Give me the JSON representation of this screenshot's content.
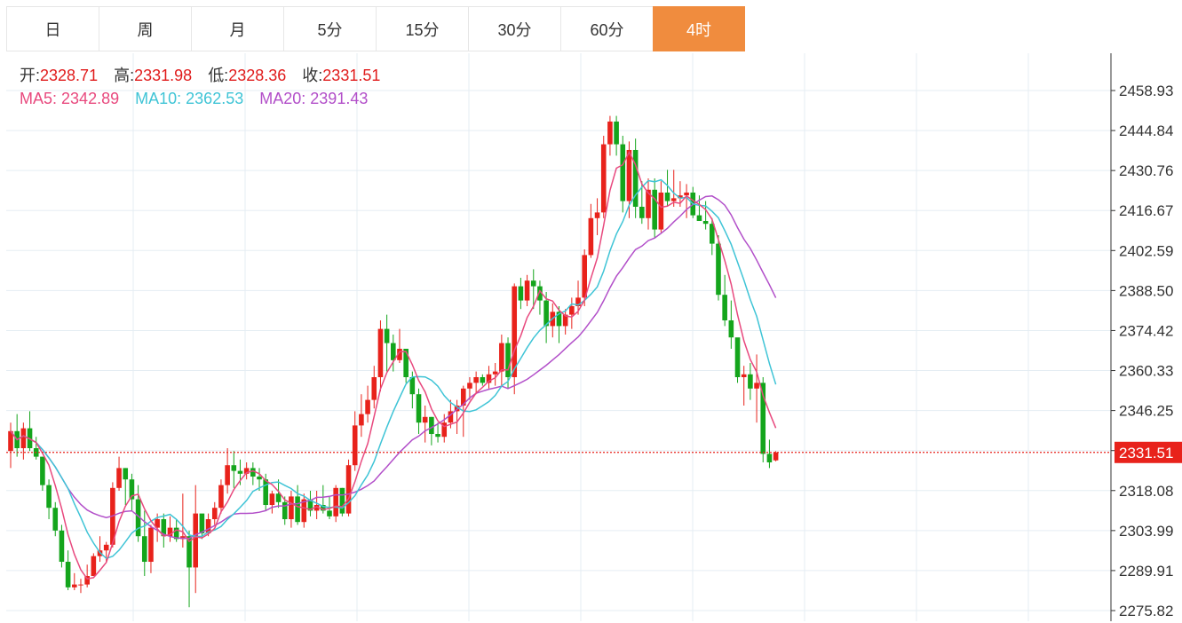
{
  "tabs": [
    {
      "label": "日",
      "active": false
    },
    {
      "label": "周",
      "active": false
    },
    {
      "label": "月",
      "active": false
    },
    {
      "label": "5分",
      "active": false
    },
    {
      "label": "15分",
      "active": false
    },
    {
      "label": "30分",
      "active": false
    },
    {
      "label": "60分",
      "active": false
    },
    {
      "label": "4时",
      "active": true
    }
  ],
  "ohlc_info": {
    "open_label": "开:",
    "open": "2328.71",
    "high_label": "高:",
    "high": "2331.98",
    "low_label": "低:",
    "low": "2328.36",
    "close_label": "收:",
    "close": "2331.51"
  },
  "ma_info": {
    "ma5_label": "MA5:",
    "ma5": "2342.89",
    "ma10_label": "MA10:",
    "ma10": "2362.53",
    "ma20_label": "MA20:",
    "ma20": "2391.43"
  },
  "colors": {
    "up": "#e8221b",
    "down": "#14a51c",
    "ma5": "#e8497e",
    "ma10": "#3fc4d6",
    "ma20": "#b24fc9",
    "price_line": "#e8221b",
    "accent_tab": "#f08c3e",
    "grid": "#e5edf3"
  },
  "chart_data": {
    "type": "candlestick",
    "y_ticks": [
      "2458.93",
      "2444.84",
      "2430.76",
      "2416.67",
      "2402.59",
      "2388.50",
      "2374.42",
      "2360.33",
      "2346.25",
      "2332.16",
      "2318.08",
      "2303.99",
      "2289.91",
      "2275.82"
    ],
    "ylim": [
      2275.82,
      2458.93
    ],
    "last_price_label": "2331.51",
    "last_price": 2331.51,
    "candles": [
      [
        2332,
        2342,
        2326,
        2339
      ],
      [
        2339,
        2345,
        2330,
        2333
      ],
      [
        2333,
        2342,
        2329,
        2340
      ],
      [
        2340,
        2346,
        2332,
        2333
      ],
      [
        2333,
        2337,
        2329,
        2330
      ],
      [
        2330,
        2330,
        2318,
        2320
      ],
      [
        2320,
        2322,
        2308,
        2312
      ],
      [
        2312,
        2314,
        2302,
        2304
      ],
      [
        2304,
        2306,
        2291,
        2293
      ],
      [
        2293,
        2297,
        2283,
        2284
      ],
      [
        2284,
        2289,
        2283,
        2285
      ],
      [
        2285,
        2287,
        2282,
        2285
      ],
      [
        2285,
        2292,
        2284,
        2288
      ],
      [
        2288,
        2296,
        2289,
        2295
      ],
      [
        2295,
        2302,
        2293,
        2297
      ],
      [
        2297,
        2300,
        2293,
        2299
      ],
      [
        2299,
        2321,
        2298,
        2319
      ],
      [
        2319,
        2330,
        2318,
        2326
      ],
      [
        2326,
        2326,
        2313,
        2322
      ],
      [
        2322,
        2324,
        2311,
        2315
      ],
      [
        2315,
        2320,
        2300,
        2302
      ],
      [
        2302,
        2311,
        2288,
        2293
      ],
      [
        2293,
        2306,
        2289,
        2305
      ],
      [
        2305,
        2310,
        2300,
        2308
      ],
      [
        2308,
        2310,
        2298,
        2302
      ],
      [
        2302,
        2309,
        2300,
        2305
      ],
      [
        2305,
        2308,
        2300,
        2301
      ],
      [
        2301,
        2317,
        2298,
        2302
      ],
      [
        2302,
        2304,
        2277,
        2291
      ],
      [
        2291,
        2320,
        2282,
        2310
      ],
      [
        2310,
        2306,
        2301,
        2303
      ],
      [
        2303,
        2310,
        2302,
        2308
      ],
      [
        2308,
        2314,
        2306,
        2312
      ],
      [
        2312,
        2322,
        2310,
        2320
      ],
      [
        2320,
        2333,
        2317,
        2327
      ],
      [
        2327,
        2332,
        2319,
        2325
      ],
      [
        2325,
        2329,
        2320,
        2324
      ],
      [
        2324,
        2328,
        2322,
        2326
      ],
      [
        2326,
        2328,
        2320,
        2323
      ],
      [
        2323,
        2326,
        2318,
        2322
      ],
      [
        2322,
        2324,
        2311,
        2313
      ],
      [
        2313,
        2318,
        2310,
        2317
      ],
      [
        2317,
        2322,
        2312,
        2314
      ],
      [
        2314,
        2316,
        2306,
        2308
      ],
      [
        2308,
        2318,
        2305,
        2316
      ],
      [
        2316,
        2320,
        2306,
        2307
      ],
      [
        2307,
        2317,
        2305,
        2315
      ],
      [
        2315,
        2318,
        2309,
        2311
      ],
      [
        2311,
        2318,
        2308,
        2313
      ],
      [
        2313,
        2320,
        2310,
        2311
      ],
      [
        2311,
        2316,
        2308,
        2309
      ],
      [
        2309,
        2320,
        2307,
        2319
      ],
      [
        2319,
        2319,
        2309,
        2310
      ],
      [
        2310,
        2329,
        2309,
        2327
      ],
      [
        2327,
        2346,
        2325,
        2341
      ],
      [
        2341,
        2352,
        2337,
        2345
      ],
      [
        2345,
        2355,
        2342,
        2350
      ],
      [
        2350,
        2362,
        2347,
        2358
      ],
      [
        2358,
        2378,
        2353,
        2375
      ],
      [
        2375,
        2380,
        2360,
        2370
      ],
      [
        2370,
        2373,
        2360,
        2364
      ],
      [
        2364,
        2375,
        2363,
        2368
      ],
      [
        2368,
        2368,
        2356,
        2358
      ],
      [
        2358,
        2360,
        2347,
        2352
      ],
      [
        2352,
        2354,
        2338,
        2342
      ],
      [
        2342,
        2348,
        2335,
        2344
      ],
      [
        2344,
        2344,
        2334,
        2338
      ],
      [
        2338,
        2342,
        2335,
        2337
      ],
      [
        2337,
        2345,
        2335,
        2342
      ],
      [
        2342,
        2350,
        2340,
        2346
      ],
      [
        2346,
        2350,
        2338,
        2348
      ],
      [
        2348,
        2355,
        2337,
        2354
      ],
      [
        2354,
        2358,
        2350,
        2356
      ],
      [
        2356,
        2360,
        2352,
        2358
      ],
      [
        2358,
        2359,
        2355,
        2356
      ],
      [
        2356,
        2362,
        2354,
        2359
      ],
      [
        2359,
        2363,
        2355,
        2360
      ],
      [
        2360,
        2373,
        2355,
        2370
      ],
      [
        2370,
        2372,
        2354,
        2358
      ],
      [
        2358,
        2391,
        2352,
        2390
      ],
      [
        2390,
        2393,
        2382,
        2385
      ],
      [
        2385,
        2394,
        2383,
        2392
      ],
      [
        2392,
        2396,
        2382,
        2390
      ],
      [
        2390,
        2392,
        2380,
        2385
      ],
      [
        2385,
        2388,
        2370,
        2376
      ],
      [
        2376,
        2384,
        2372,
        2381
      ],
      [
        2381,
        2383,
        2370,
        2376
      ],
      [
        2376,
        2382,
        2373,
        2380
      ],
      [
        2380,
        2386,
        2375,
        2383
      ],
      [
        2383,
        2392,
        2380,
        2386
      ],
      [
        2386,
        2403,
        2383,
        2401
      ],
      [
        2401,
        2419,
        2400,
        2414
      ],
      [
        2414,
        2421,
        2408,
        2416
      ],
      [
        2416,
        2443,
        2414,
        2440
      ],
      [
        2440,
        2450,
        2436,
        2448
      ],
      [
        2448,
        2450,
        2436,
        2440
      ],
      [
        2440,
        2443,
        2416,
        2420
      ],
      [
        2420,
        2441,
        2414,
        2438
      ],
      [
        2438,
        2442,
        2414,
        2418
      ],
      [
        2418,
        2427,
        2412,
        2414
      ],
      [
        2414,
        2428,
        2410,
        2424
      ],
      [
        2424,
        2428,
        2407,
        2410
      ],
      [
        2410,
        2427,
        2409,
        2423
      ],
      [
        2423,
        2431,
        2418,
        2420
      ],
      [
        2420,
        2431,
        2418,
        2421
      ],
      [
        2421,
        2427,
        2418,
        2422
      ],
      [
        2422,
        2426,
        2414,
        2423
      ],
      [
        2423,
        2425,
        2414,
        2415
      ],
      [
        2415,
        2422,
        2413,
        2413
      ],
      [
        2413,
        2420,
        2410,
        2412
      ],
      [
        2412,
        2414,
        2401,
        2405
      ],
      [
        2405,
        2408,
        2385,
        2387
      ],
      [
        2387,
        2394,
        2376,
        2378
      ],
      [
        2378,
        2385,
        2368,
        2372
      ],
      [
        2372,
        2370,
        2356,
        2358
      ],
      [
        2358,
        2362,
        2348,
        2359
      ],
      [
        2359,
        2363,
        2350,
        2354
      ],
      [
        2354,
        2366,
        2342,
        2356
      ],
      [
        2356,
        2358,
        2328,
        2331
      ],
      [
        2331,
        2336,
        2326,
        2328
      ],
      [
        2328.71,
        2331.98,
        2328.36,
        2331.51
      ]
    ]
  }
}
